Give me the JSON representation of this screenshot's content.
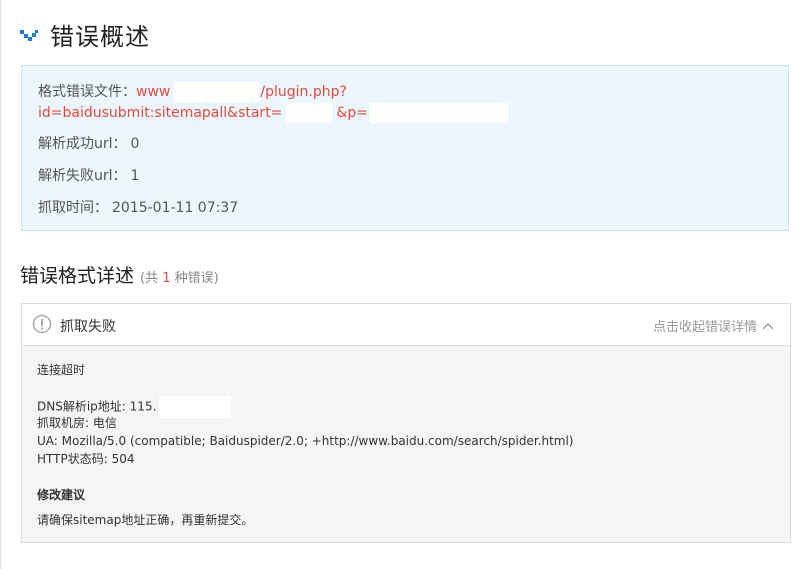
{
  "header": {
    "title": "错误概述"
  },
  "summary": {
    "file_label": "格式错误文件：",
    "url_part1": "www",
    "url_part2": "/plugin.php?",
    "url_line2a": "id=baidusubmit:sitemapall&start=",
    "url_line2b": "&p=",
    "success_label": "解析成功url：",
    "success_value": "0",
    "fail_label": "解析失败url：",
    "fail_value": "1",
    "time_label": "抓取时间：",
    "time_value": "2015-01-11 07:37"
  },
  "details": {
    "title": "错误格式详述",
    "count_prefix": "(共",
    "count": "1",
    "count_suffix": "种错误)",
    "error_name": "抓取失败",
    "collapse_label": "点击收起错误详情",
    "timeout": "连接超时",
    "dns_label": "DNS解析ip地址:",
    "dns_value": "115.",
    "room_label": "抓取机房:",
    "room_value": "电信",
    "ua_label": "UA:",
    "ua_value": "Mozilla/5.0 (compatible; Baiduspider/2.0; +http://www.baidu.com/search/spider.html)",
    "http_label": "HTTP状态码:",
    "http_value": "504",
    "suggest_title": "修改建议",
    "suggest_text": "请确保sitemap地址正确，再重新提交。"
  },
  "colors": {
    "accent_red": "#e44a3c",
    "info_bg": "#ebf6fd",
    "icon_blue": "#1a7fd4"
  }
}
